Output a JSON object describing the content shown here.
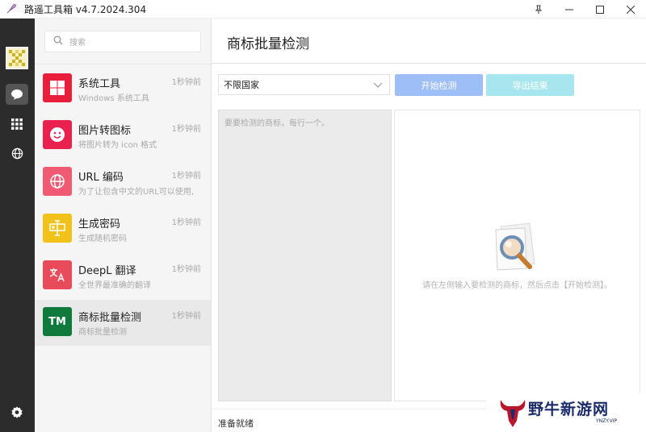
{
  "window": {
    "title": "路遥工具箱 v4.7.2024.304",
    "controls": [
      "pin-icon",
      "minimize-icon",
      "maximize-icon",
      "close-icon"
    ]
  },
  "rail": {
    "items": [
      "chat-icon",
      "apps-grid-icon",
      "globe-icon"
    ],
    "bottom": "settings-icon"
  },
  "search": {
    "placeholder": "搜索"
  },
  "tools": [
    {
      "title": "系统工具",
      "subtitle": "Windows 系统工具",
      "time": "1秒钟前",
      "icon": "windows-icon",
      "color": "#e81e3a"
    },
    {
      "title": "图片转图标",
      "subtitle": "将图片转为 icon 格式",
      "time": "1秒钟前",
      "icon": "smile-icon",
      "color": "#e8214f"
    },
    {
      "title": "URL 编码",
      "subtitle": "为了让包含中文的URL可以使用,",
      "time": "1秒钟前",
      "icon": "globe-icon",
      "color": "#f05a72"
    },
    {
      "title": "生成密码",
      "subtitle": "生成随机密码",
      "time": "1秒钟前",
      "icon": "password-icon",
      "color": "#f2c21b"
    },
    {
      "title": "DeepL 翻译",
      "subtitle": "全世界最准确的翻译",
      "time": "1秒钟前",
      "icon": "translate-icon",
      "color": "#ea4b5a"
    },
    {
      "title": "商标批量检测",
      "subtitle": "商标批量检测",
      "time": "1秒钟前",
      "icon": "TM",
      "color": "#0f7a3b"
    }
  ],
  "main": {
    "title": "商标批量检测",
    "country_select": "不限国家",
    "start_button": "开始检测",
    "export_button": "导出结果",
    "input_placeholder": "要要检测的商标，每行一个。",
    "empty_hint": "请在左侧输入要检测的商标，然后点击【开始检测】。",
    "status": "准备就绪"
  },
  "watermark": {
    "text": "野牛新游网",
    "sub": "YNZY.VIP"
  }
}
